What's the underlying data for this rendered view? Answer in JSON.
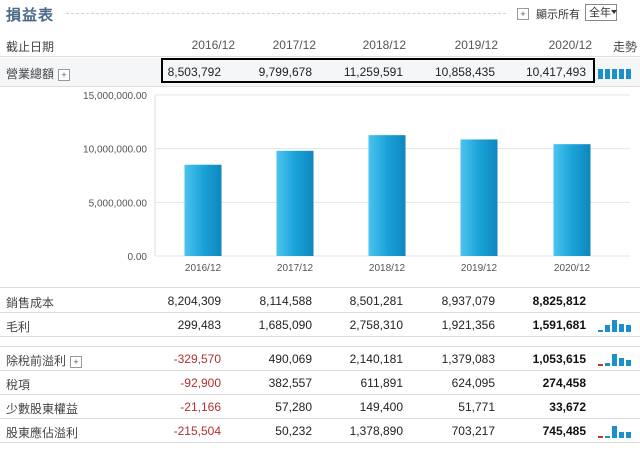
{
  "header": {
    "title": "損益表",
    "show_all_label": "顯示所有",
    "period_select": "全年",
    "expand_symbol": "+"
  },
  "columns": {
    "label_header": "截止日期",
    "years": [
      "2016/12",
      "2017/12",
      "2018/12",
      "2019/12",
      "2020/12"
    ],
    "trend_header": "走勢"
  },
  "revenue_row": {
    "label": "營業總額",
    "values": [
      "8,503,792",
      "9,799,678",
      "11,259,591",
      "10,858,435",
      "10,417,493"
    ]
  },
  "chart_data": {
    "type": "bar",
    "categories": [
      "2016/12",
      "2017/12",
      "2018/12",
      "2019/12",
      "2020/12"
    ],
    "values": [
      8503792,
      9799678,
      11259591,
      10858435,
      10417493
    ],
    "yticks": [
      "15,000,000.00",
      "10,000,000.00",
      "5,000,000.00",
      "0.00"
    ],
    "ylim": [
      0,
      15000000
    ],
    "bar_color": "#1aa3d9",
    "bar_color_light": "#4cc4ee"
  },
  "rows": [
    {
      "label": "銷售成本",
      "values": [
        "8,204,309",
        "8,114,588",
        "8,501,281",
        "8,937,079",
        "8,825,812"
      ],
      "spark": false
    },
    {
      "label": "毛利",
      "values": [
        "299,483",
        "1,685,090",
        "2,758,310",
        "1,921,356",
        "1,591,681"
      ],
      "spark": true
    },
    {
      "label": "除稅前溢利",
      "values": [
        "-329,570",
        "490,069",
        "2,140,181",
        "1,379,083",
        "1,053,615"
      ],
      "spark": true,
      "has_plus": true
    },
    {
      "label": "稅項",
      "values": [
        "-92,900",
        "382,557",
        "611,891",
        "624,095",
        "274,458"
      ],
      "spark": false
    },
    {
      "label": "少數股東權益",
      "values": [
        "-21,166",
        "57,280",
        "149,400",
        "51,771",
        "33,672"
      ],
      "spark": false
    },
    {
      "label": "股東應佔溢利",
      "values": [
        "-215,504",
        "50,232",
        "1,378,890",
        "703,217",
        "745,485"
      ],
      "spark": true
    }
  ],
  "colors": {
    "title": "#4a6a8a",
    "negative": "#b03030",
    "spark_blue": "#1a8fc9",
    "spark_red": "#c0392b"
  }
}
